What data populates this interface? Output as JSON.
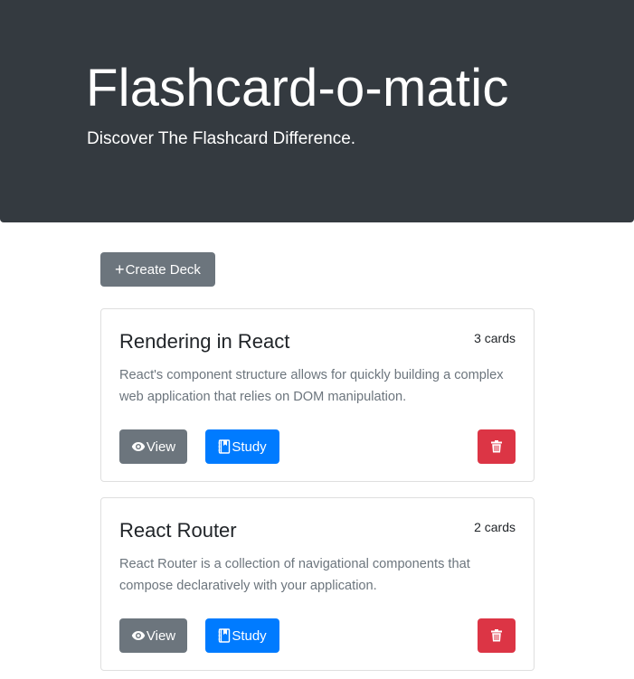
{
  "header": {
    "title": "Flashcard-o-matic",
    "subtitle": "Discover The Flashcard Difference."
  },
  "actions": {
    "create_deck_icon": "plus-icon",
    "create_deck_label": "Create Deck"
  },
  "decks": [
    {
      "name": "Rendering in React",
      "card_count": "3 cards",
      "description": "React's component structure allows for quickly building a complex web application that relies on DOM manipulation.",
      "view_label": "View",
      "study_label": "Study",
      "view_icon": "eye-icon",
      "study_icon": "book-icon",
      "delete_icon": "trash-icon"
    },
    {
      "name": "React Router",
      "card_count": "2 cards",
      "description": "React Router is a collection of navigational components that compose declaratively with your application.",
      "view_label": "View",
      "study_label": "Study",
      "view_icon": "eye-icon",
      "study_icon": "book-icon",
      "delete_icon": "trash-icon"
    }
  ],
  "colors": {
    "header_bg": "#343a40",
    "secondary": "#6c757d",
    "primary": "#007bff",
    "danger": "#dc3545"
  }
}
